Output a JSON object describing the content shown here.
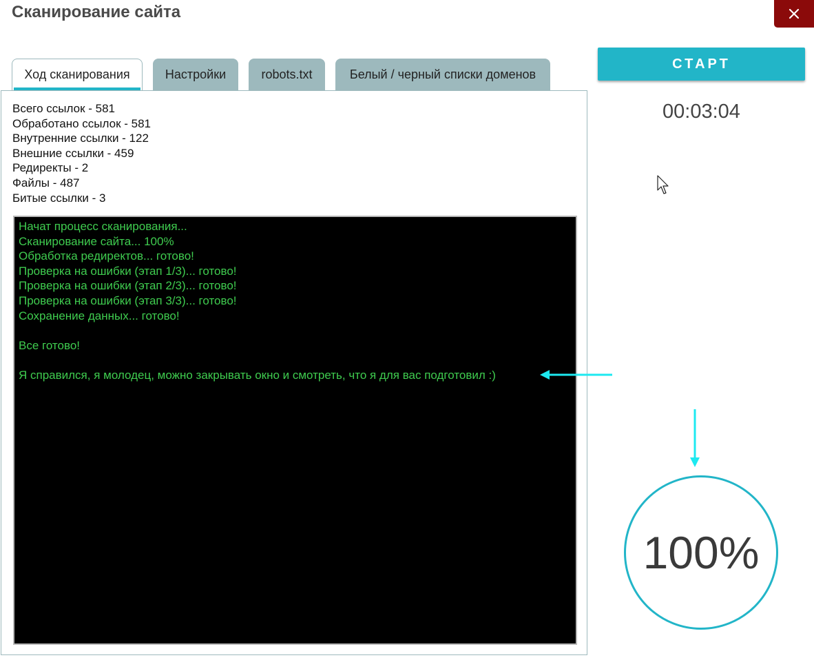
{
  "window": {
    "title": "Сканирование сайта",
    "close_icon": "close-icon"
  },
  "tabs": [
    {
      "label": "Ход сканирования",
      "active": true
    },
    {
      "label": "Настройки",
      "active": false
    },
    {
      "label": "robots.txt",
      "active": false
    },
    {
      "label": "Белый / черный списки доменов",
      "active": false
    }
  ],
  "stats": [
    "Всего ссылок - 581",
    "Обработано ссылок - 581",
    "Внутренние ссылки - 122",
    "Внешние ссылки - 459",
    "Редиректы - 2",
    "Файлы - 487",
    "Битые ссылки - 3"
  ],
  "console": {
    "lines": [
      "Начат процесс сканирования...",
      "Сканирование сайта... 100%",
      "Обработка редиректов... готово!",
      "Проверка на ошибки (этап 1/3)... готово!",
      "Проверка на ошибки (этап 2/3)... готово!",
      "Проверка на ошибки (этап 3/3)... готово!",
      "Сохранение данных... готово!",
      "",
      "Все готово!",
      "",
      "Я справился, я молодец, можно закрывать окно и смотреть, что я для вас подготовил :)"
    ],
    "text_color": "#3fcc4f"
  },
  "controls": {
    "start_label": "СТАРТ",
    "timer": "00:03:04"
  },
  "progress": {
    "percent": 100,
    "label": "100%"
  },
  "colors": {
    "accent": "#22b5c8",
    "close": "#8b0a0a",
    "tab_inactive": "#9db9bd",
    "annotation_arrow": "#1de9f0"
  }
}
